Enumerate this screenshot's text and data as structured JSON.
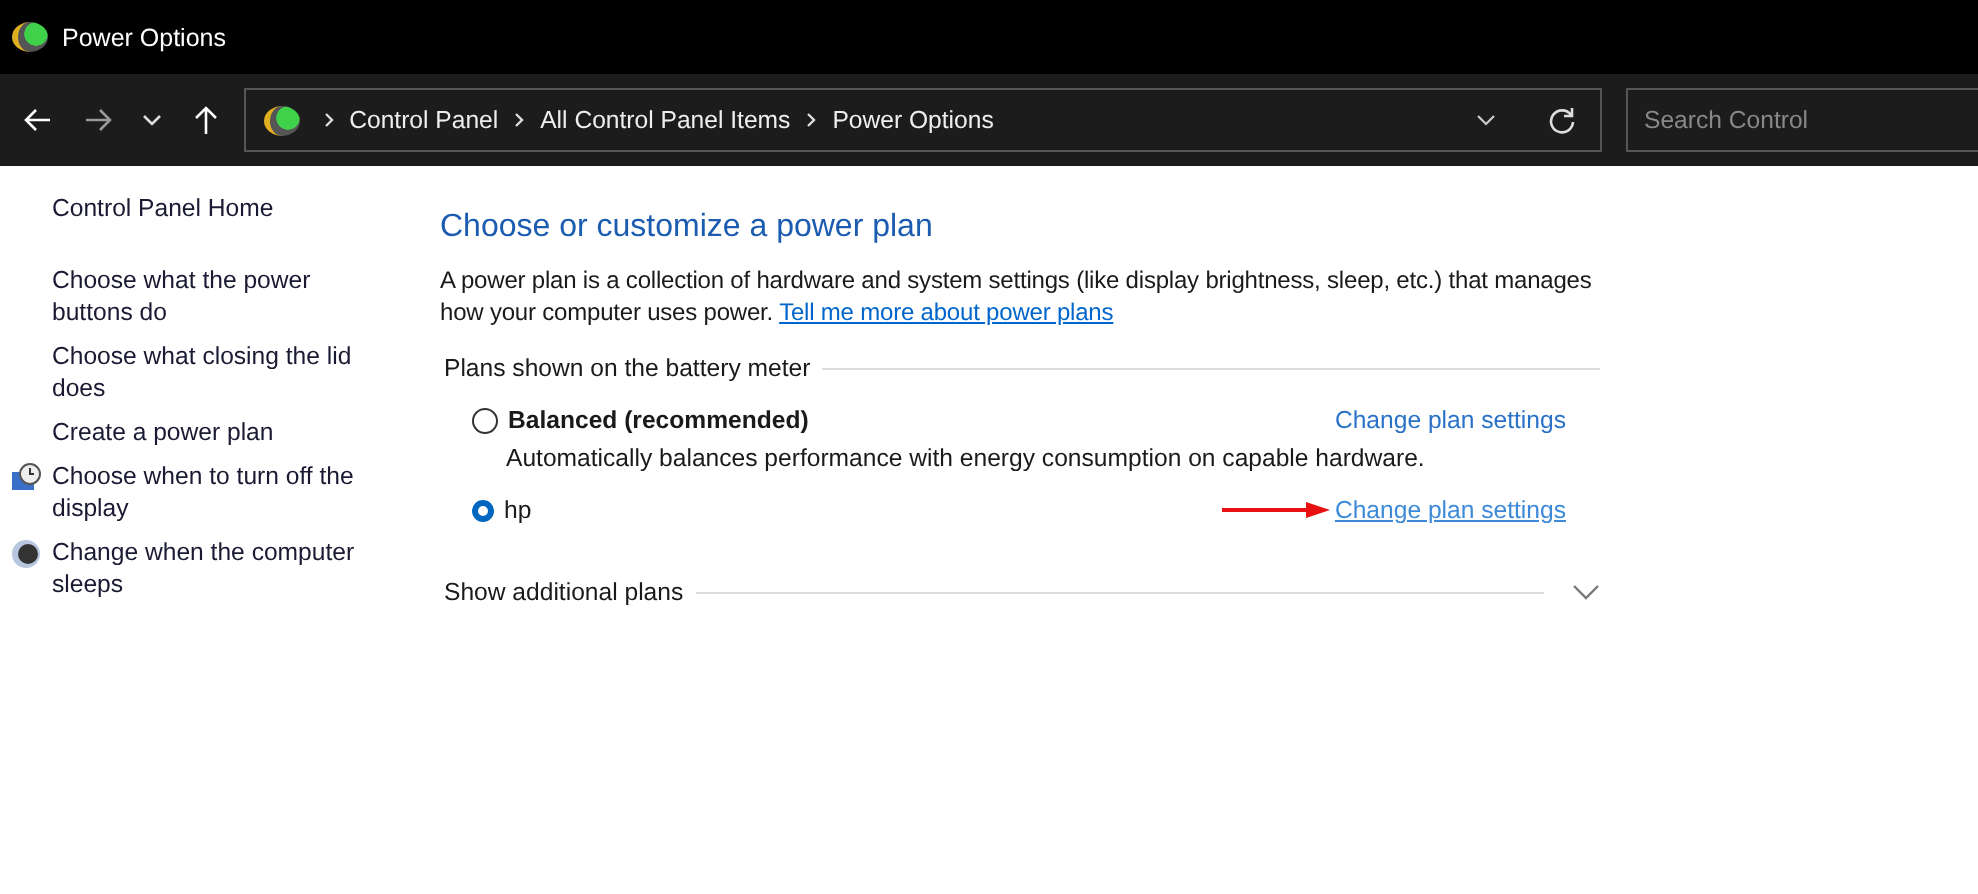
{
  "window": {
    "title": "Power Options"
  },
  "address_bar": {
    "crumbs": [
      "Control Panel",
      "All Control Panel Items",
      "Power Options"
    ]
  },
  "search": {
    "placeholder": "Search Control"
  },
  "sidebar": {
    "items": [
      {
        "label": "Control Panel Home",
        "kind": "home"
      },
      {
        "label": "Choose what the power buttons do",
        "kind": "plain"
      },
      {
        "label": "Choose what closing the lid does",
        "kind": "plain"
      },
      {
        "label": "Create a power plan",
        "kind": "plain"
      },
      {
        "label": "Choose when to turn off the display",
        "kind": "display"
      },
      {
        "label": "Change when the computer sleeps",
        "kind": "sleep"
      }
    ]
  },
  "main": {
    "heading": "Choose or customize a power plan",
    "description": "A power plan is a collection of hardware and system settings (like display brightness, sleep, etc.) that manages how your computer uses power.",
    "link": "Tell me more about power plans",
    "group_label": "Plans shown on the battery meter",
    "plans": [
      {
        "name": "Balanced (recommended)",
        "selected": false,
        "bold": true,
        "description": "Automatically balances performance with energy consumption on capable hardware.",
        "link": "Change plan settings",
        "hovered": false
      },
      {
        "name": "hp",
        "selected": true,
        "bold": false,
        "link": "Change plan settings",
        "hovered": true
      }
    ],
    "more": "Show additional plans"
  }
}
